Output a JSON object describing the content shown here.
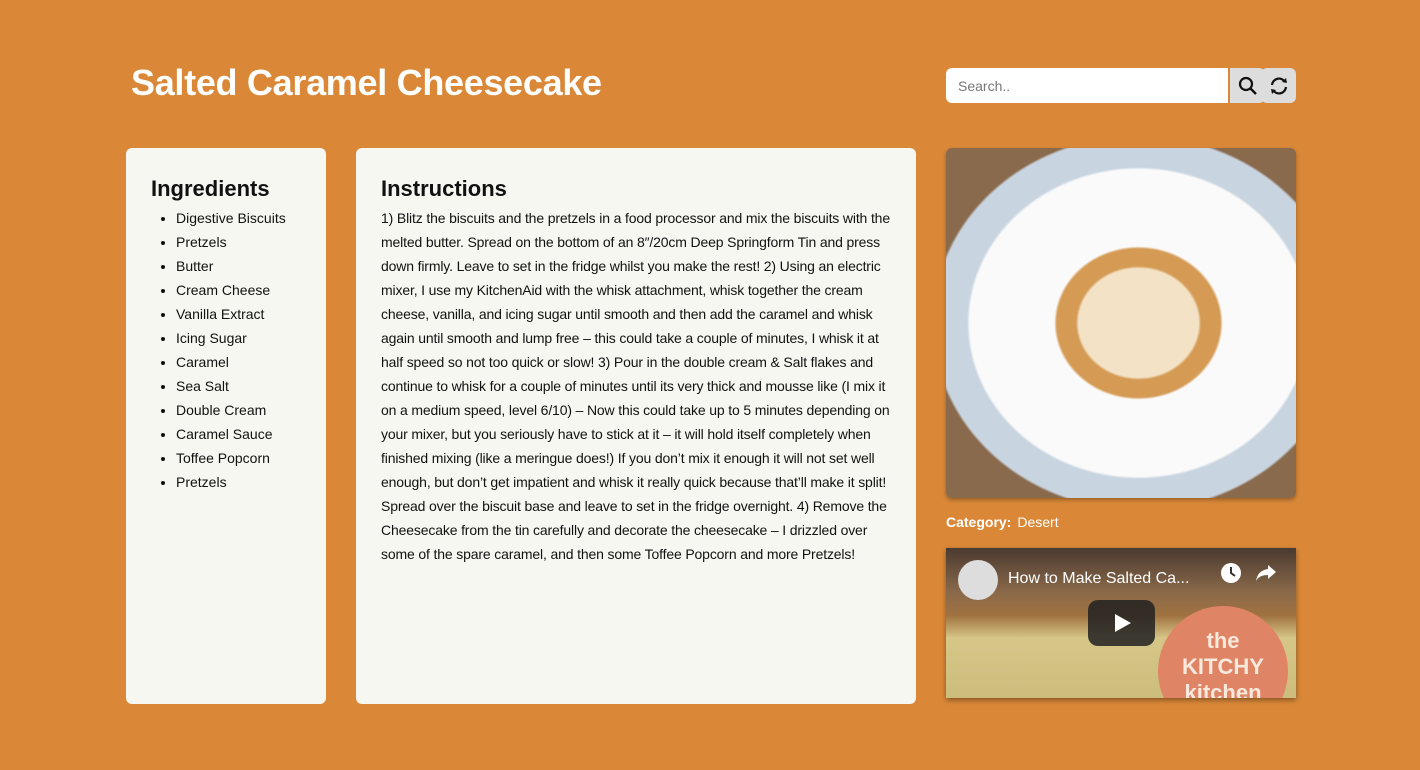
{
  "header": {
    "title": "Salted Caramel Cheesecake"
  },
  "search": {
    "placeholder": "Search..",
    "value": "",
    "search_icon": "magnifier-icon",
    "refresh_icon": "refresh-icon"
  },
  "ingredients": {
    "heading": "Ingredients",
    "items": [
      "Digestive Biscuits",
      "Pretzels",
      "Butter",
      "Cream Cheese",
      "Vanilla Extract",
      "Icing Sugar",
      "Caramel",
      "Sea Salt",
      "Double Cream",
      "Caramel Sauce",
      "Toffee Popcorn",
      "Pretzels"
    ]
  },
  "instructions": {
    "heading": "Instructions",
    "text": "1) Blitz the biscuits and the pretzels in a food processor and mix the biscuits with the melted butter. Spread on the bottom of an 8″/20cm Deep Springform Tin and press down firmly. Leave to set in the fridge whilst you make the rest! 2) Using an electric mixer, I use my KitchenAid with the whisk attachment, whisk together the cream cheese, vanilla, and icing sugar until smooth and then add the caramel and whisk again until smooth and lump free – this could take a couple of minutes, I whisk it at half speed so not too quick or slow! 3) Pour in the double cream & Salt flakes and continue to whisk for a couple of minutes until its very thick and mousse like (I mix it on a medium speed, level 6/10) – Now this could take up to 5 minutes depending on your mixer, but you seriously have to stick at it – it will hold itself completely when finished mixing (like a meringue does!) If you don’t mix it enough it will not set well enough, but don’t get impatient and whisk it really quick because that’ll make it split! Spread over the biscuit base and leave to set in the fridge overnight. 4) Remove the Cheesecake from the tin carefully and decorate the cheesecake – I drizzled over some of the spare caramel, and then some Toffee Popcorn and more Pretzels!"
  },
  "category": {
    "label": "Category:",
    "value": "Desert"
  },
  "video": {
    "title": "How to Make Salted Ca...",
    "logo_text": "the KITCHY kitchen"
  },
  "colors": {
    "background": "#DA8838",
    "panel": "#F7F7F2"
  }
}
